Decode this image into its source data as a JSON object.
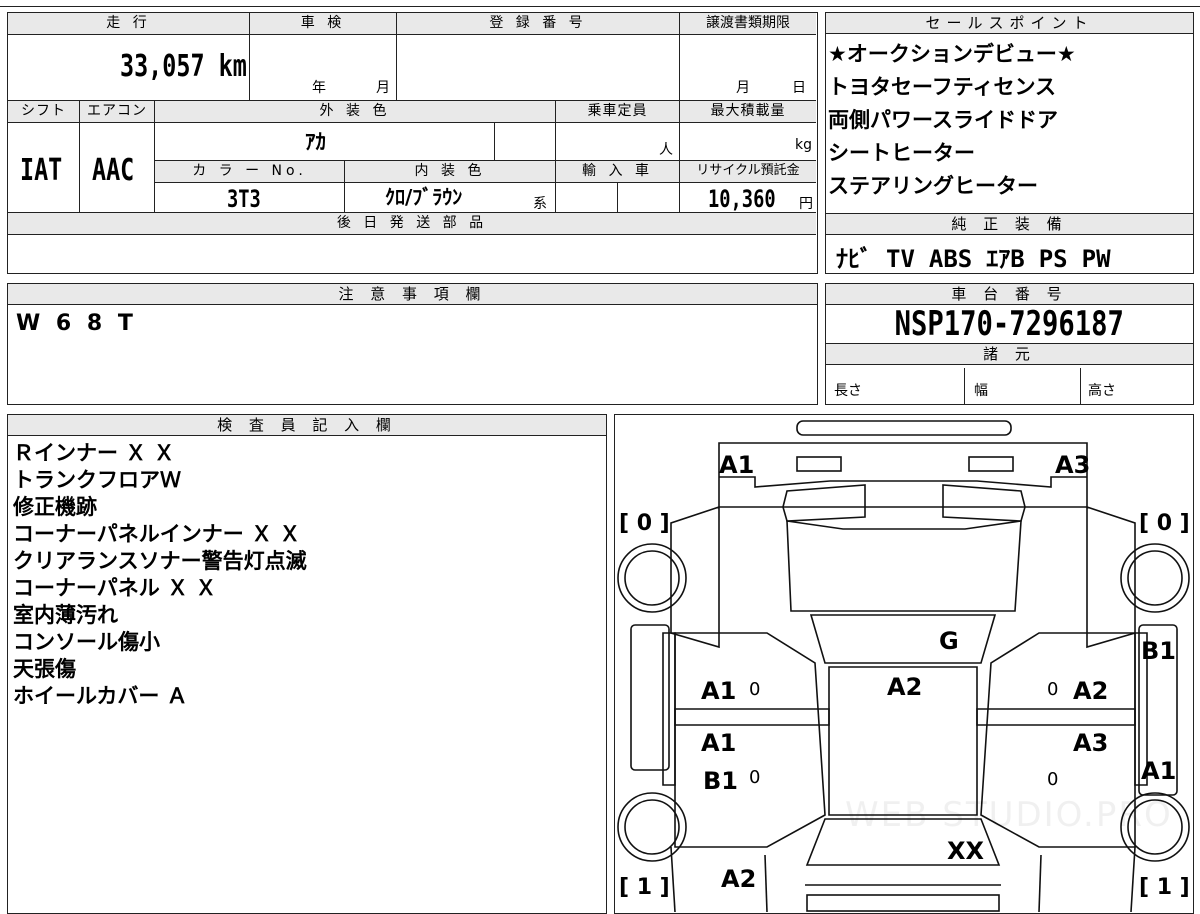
{
  "top_form": {
    "mileage_label": "走 行",
    "mileage_value": "33,057 km",
    "shaken_label": "車 検",
    "shaken_year": "年",
    "shaken_month": "月",
    "reg_no_label": "登 録 番 号",
    "transfer_label": "譲渡書類期限",
    "transfer_month": "月",
    "transfer_day": "日",
    "shift_label": "シフト",
    "shift_value": "IAT",
    "ac_label": "エアコン",
    "ac_value": "AAC",
    "ext_color_label": "外 装 色",
    "ext_color_value": "ｱｶ",
    "capacity_label": "乗車定員",
    "capacity_unit": "人",
    "max_load_label": "最大積載量",
    "max_load_unit": "kg",
    "color_no_label": "カ ラ ー No.",
    "color_no_value": "3T3",
    "int_color_label": "内 装 色",
    "int_color_value": "ｸﾛ/ﾌﾞﾗｳﾝ",
    "int_color_suffix": "系",
    "import_label": "輸 入 車",
    "recycle_label": "リサイクル預託金",
    "recycle_value": "10,360",
    "recycle_unit": "円",
    "later_parts_label": "後 日 発 送 部 品"
  },
  "sales_points": {
    "header": "セールスポイント",
    "items": [
      "★オークションデビュー★",
      "トヨタセーフティセンス",
      "両側パワースライドドア",
      "シートヒーター",
      "ステアリングヒーター"
    ]
  },
  "equipment": {
    "header": "純 正 装 備",
    "items": [
      "ﾅﾋﾞ",
      "TV",
      "ABS",
      "ｴｱB",
      "PS",
      "PW"
    ]
  },
  "notes": {
    "header": "注 意 事 項 欄",
    "text": "W 6 8 T"
  },
  "chassis": {
    "header": "車 台 番 号",
    "value": "NSP170-7296187",
    "specs_header": "諸 元",
    "length": "長さ",
    "width": "幅",
    "height": "高さ"
  },
  "inspector": {
    "header": "検 査 員 記 入 欄",
    "lines": [
      "Ｒインナー Ｘ Ｘ",
      "トランクフロアＷ",
      "修正機跡",
      "コーナーパネルインナー Ｘ Ｘ",
      "クリアランスソナー警告灯点滅",
      "コーナーパネル Ｘ Ｘ",
      "室内薄汚れ",
      "コンソール傷小",
      "天張傷",
      "ホイールカバー Ａ"
    ]
  },
  "diagram": {
    "labels": {
      "front_left": "A1",
      "front_right": "A3",
      "tire_fl": "[ 0 ]",
      "tire_fr": "[ 0 ]",
      "tire_rl": "[ 1 ]",
      "tire_rr": "[ 1 ]",
      "windshield": "G",
      "roof": "A2",
      "door_fl": "A1",
      "door_fr": "A2",
      "door_rl_1": "A1",
      "door_rl_2": "B1",
      "door_rr": "A3",
      "side_r1": "B1",
      "side_r2": "A1",
      "rear": "XX",
      "rear_bottom": "A2",
      "zero_1": "0",
      "zero_2": "0",
      "zero_3": "0",
      "zero_4": "0"
    },
    "watermark": "WEB STUDIO.PRO"
  }
}
